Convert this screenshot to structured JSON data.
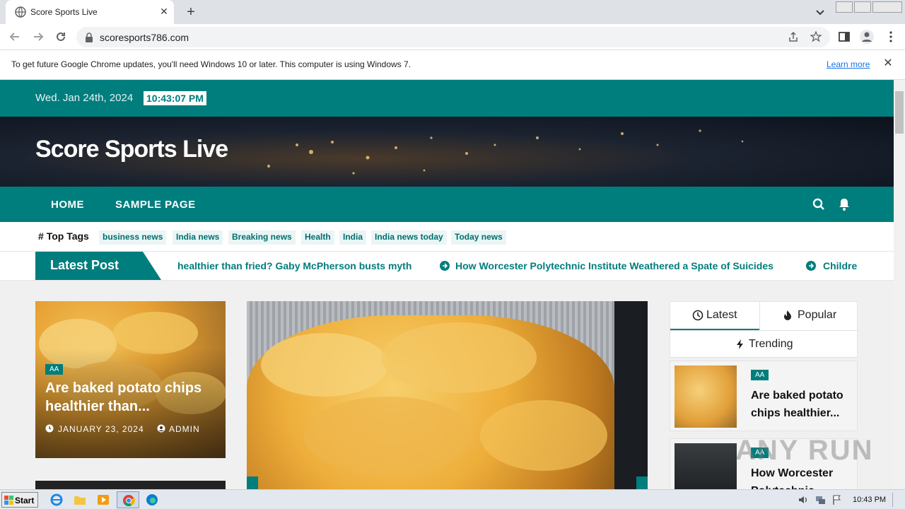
{
  "browser": {
    "tab_title": "Score Sports Live",
    "url": "scoresports786.com",
    "infobar_text": "To get future Google Chrome updates, you'll need Windows 10 or later. This computer is using Windows 7.",
    "infobar_link": "Learn more"
  },
  "site": {
    "date": "Wed. Jan 24th, 2024",
    "time": "10:43:07 PM",
    "title": "Score Sports Live",
    "nav": [
      "HOME",
      "SAMPLE PAGE"
    ],
    "top_tags_label": "Top Tags",
    "tags": [
      "business news",
      "India news",
      "Breaking news",
      "Health",
      "India",
      "India news today",
      "Today news"
    ],
    "latest_label": "Latest Post",
    "ticker": [
      "healthier than fried? Gaby McPherson busts myth",
      "How Worcester Polytechnic Institute Weathered a Spate of Suicides",
      "Childre"
    ]
  },
  "featured": {
    "badge": "AA",
    "title": "Are baked potato chips healthier than...",
    "date": "JANUARY 23, 2024",
    "author": "ADMIN"
  },
  "sidebar": {
    "tabs": [
      "Latest",
      "Popular",
      "Trending"
    ],
    "items": [
      {
        "badge": "AA",
        "title": "Are baked potato chips healthier..."
      },
      {
        "badge": "AA",
        "title": "How Worcester Polytechnic"
      }
    ]
  },
  "watermark": "ANY RUN",
  "taskbar": {
    "start": "Start",
    "time": "10:43 PM"
  }
}
